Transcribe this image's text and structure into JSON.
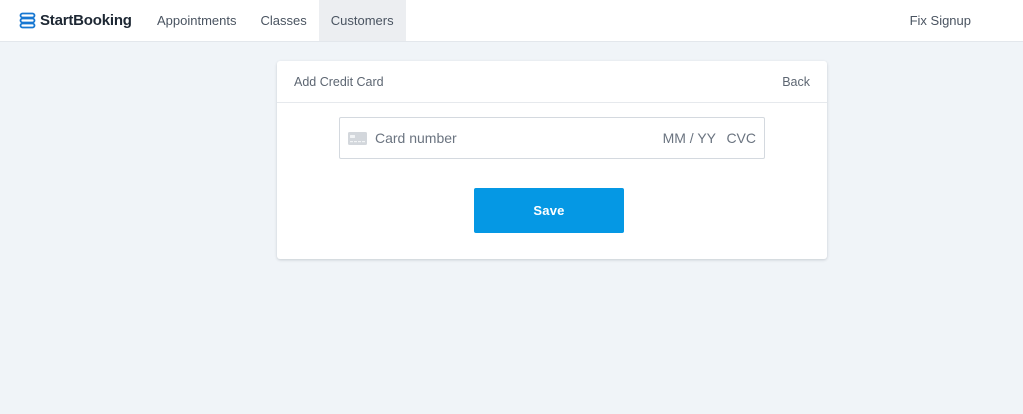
{
  "brand": {
    "name": "StartBooking",
    "accent_color": "#1677d2",
    "icon": "startbooking-logo-icon"
  },
  "nav": {
    "items": [
      {
        "label": "Appointments",
        "active": false
      },
      {
        "label": "Classes",
        "active": false
      },
      {
        "label": "Customers",
        "active": true
      }
    ],
    "right_link": "Fix Signup"
  },
  "card_form": {
    "title": "Add Credit Card",
    "back_label": "Back",
    "card_icon": "credit-card-icon",
    "card_number_placeholder": "Card number",
    "card_number_value": "",
    "expiry_placeholder": "MM / YY",
    "expiry_value": "",
    "cvc_placeholder": "CVC",
    "cvc_value": "",
    "save_label": "Save",
    "save_color": "#0598e4"
  }
}
